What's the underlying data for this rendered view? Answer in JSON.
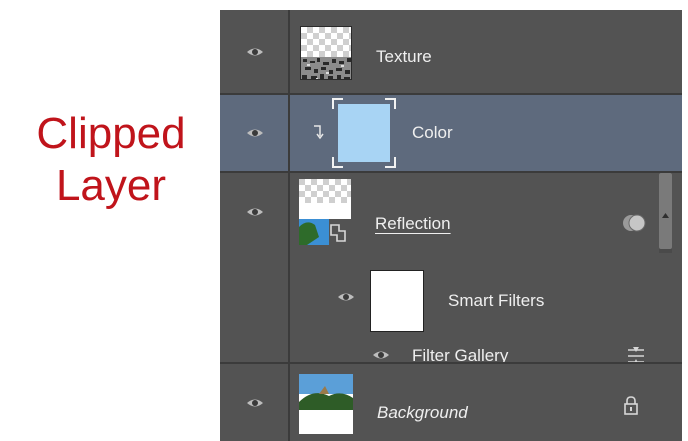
{
  "annotation": {
    "line1": "Clipped",
    "line2": "Layer"
  },
  "layers": {
    "texture": {
      "name": "Texture",
      "visibility_icon": "eye-icon"
    },
    "color": {
      "name": "Color",
      "clipped": true,
      "fill_color": "#a8d4f4",
      "visibility_icon": "eye-icon",
      "clip_icon": "clipping-arrow-icon"
    },
    "reflection": {
      "name": "Reflection",
      "smart_object": true,
      "visibility_icon": "eye-icon",
      "effects_icon": "smart-filter-indicator-icon"
    },
    "smart_filters": {
      "name": "Smart Filters",
      "visibility_icon": "eye-icon"
    },
    "filter_gallery": {
      "name": "Filter Gallery",
      "visibility_icon": "eye-icon",
      "options_icon": "blending-options-icon"
    },
    "background": {
      "name": "Background",
      "locked": true,
      "visibility_icon": "eye-icon",
      "lock_icon": "lock-icon"
    }
  },
  "colors": {
    "annotation_text": "#c0141b",
    "panel_background": "#535353",
    "selected_row": "#5e6a7d",
    "separator": "#3b3b3b",
    "label_text": "#efefef"
  }
}
